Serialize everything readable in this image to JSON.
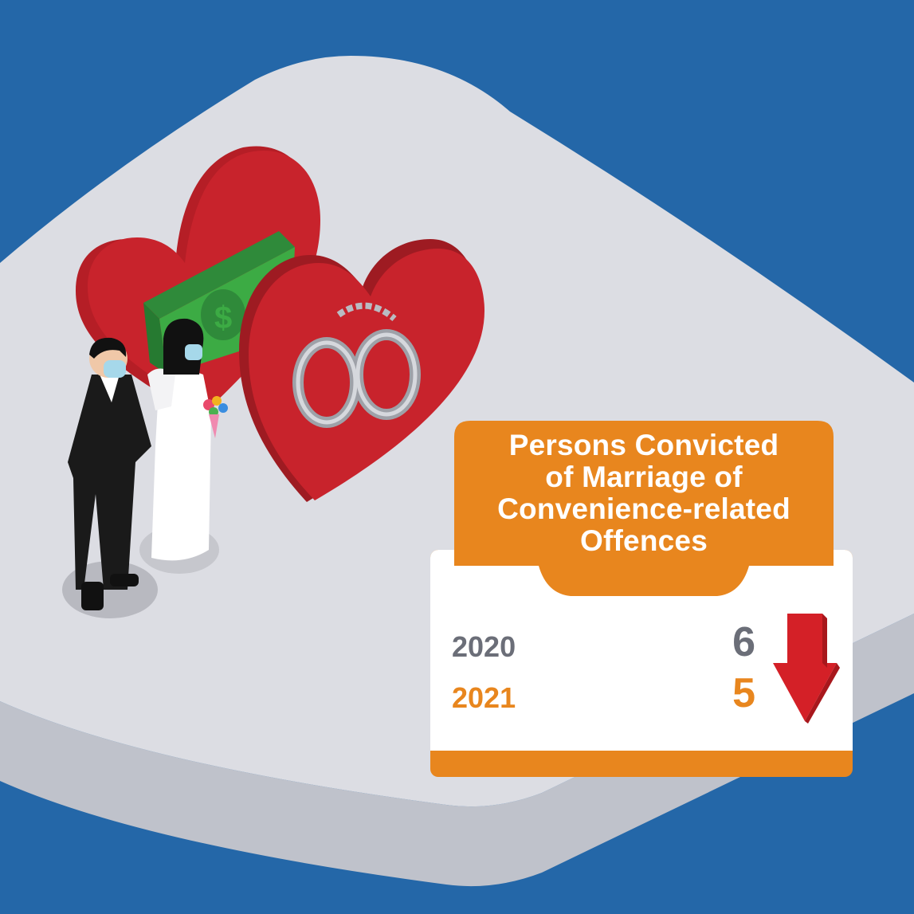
{
  "colors": {
    "background": "#2467a8",
    "platform": "#dcdde3",
    "accent_orange": "#e8861e",
    "arrow_red": "#d42027",
    "year_previous": "#6b6e78",
    "year_current": "#e8861e"
  },
  "card": {
    "title": "Persons Convicted of Marriage of Convenience-related Offences",
    "title_lines": [
      "Persons Convicted",
      "of Marriage of",
      "Convenience-related",
      "Offences"
    ],
    "rows": [
      {
        "year": "2020",
        "value": "6"
      },
      {
        "year": "2021",
        "value": "5"
      }
    ],
    "trend": "down-arrow-icon"
  },
  "illustration": {
    "icons": [
      "heart-icon",
      "dollar-bill-icon",
      "handcuffs-icon",
      "groom-figure",
      "bride-figure",
      "bouquet-icon"
    ]
  }
}
